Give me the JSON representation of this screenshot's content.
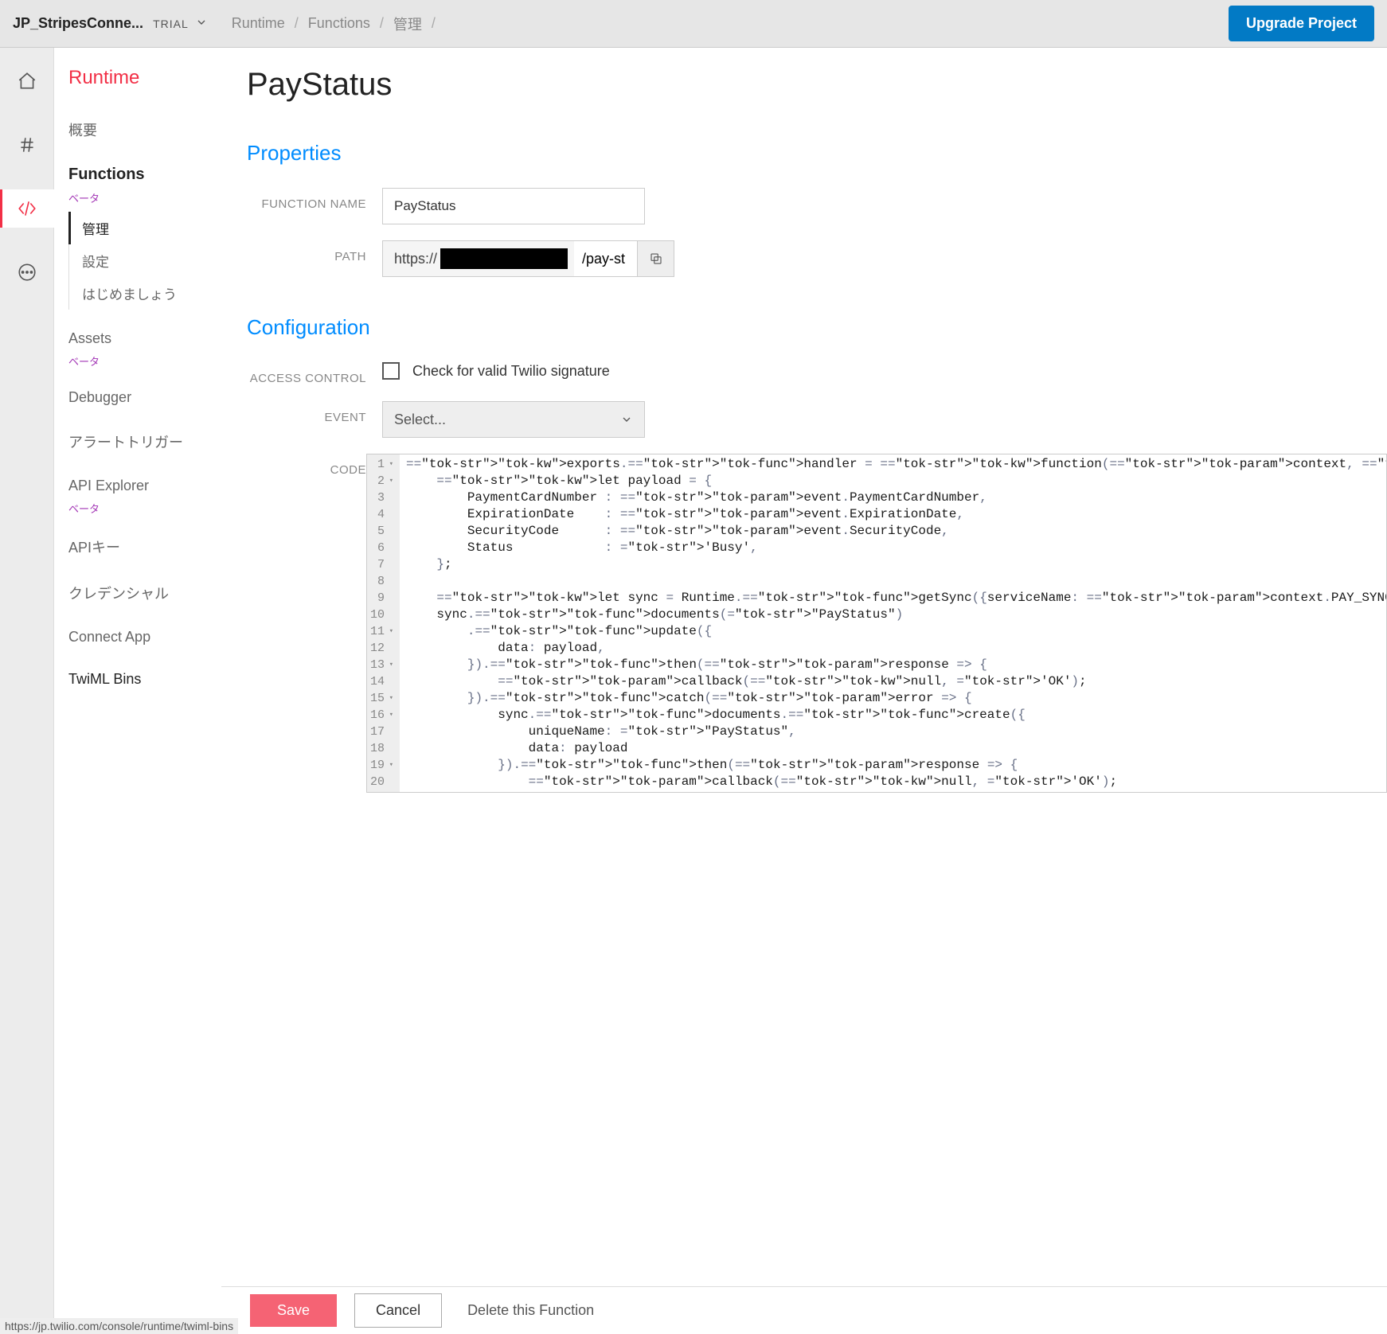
{
  "topbar": {
    "project_name": "JP_StripesConne...",
    "trial": "TRIAL",
    "breadcrumb": [
      "Runtime",
      "Functions",
      "管理"
    ],
    "upgrade": "Upgrade Project"
  },
  "sidebar": {
    "title": "Runtime",
    "overview": "概要",
    "functions": {
      "label": "Functions",
      "badge": "ベータ"
    },
    "subnav": {
      "manage": "管理",
      "settings": "設定",
      "getting_started": "はじめましょう"
    },
    "assets": {
      "label": "Assets",
      "badge": "ベータ"
    },
    "debugger": "Debugger",
    "alert_triggers": "アラートトリガー",
    "api_explorer": {
      "label": "API Explorer",
      "badge": "ベータ"
    },
    "api_keys": "APIキー",
    "credentials": "クレデンシャル",
    "connect_app": "Connect App",
    "twiml_bins": "TwiML Bins"
  },
  "page": {
    "title": "PayStatus",
    "properties_heading": "Properties",
    "configuration_heading": "Configuration",
    "labels": {
      "function_name": "FUNCTION NAME",
      "path": "PATH",
      "access_control": "ACCESS CONTROL",
      "event": "EVENT",
      "code": "CODE"
    },
    "function_name_value": "PayStatus",
    "path_prefix": "https://",
    "path_suffix": "/pay-st",
    "access_checkbox_label": "Check for valid Twilio signature",
    "event_placeholder": "Select...",
    "code_lines": [
      "exports.handler = function(context, event, callback) {",
      "    let payload = {",
      "        PaymentCardNumber : event.PaymentCardNumber,",
      "        ExpirationDate    : event.ExpirationDate,",
      "        SecurityCode      : event.SecurityCode,",
      "        Status            : 'Busy',",
      "    };",
      "",
      "    let sync = Runtime.getSync({serviceName: context.PAY_SYNC_SE",
      "    sync.documents(\"PayStatus\")",
      "        .update({",
      "            data: payload,",
      "        }).then(response => {",
      "            callback(null, 'OK');",
      "        }).catch(error => {",
      "            sync.documents.create({",
      "                uniqueName: \"PayStatus\",",
      "                data: payload",
      "            }).then(response => {",
      "                callback(null, 'OK');"
    ],
    "fold_lines": [
      1,
      2,
      11,
      13,
      15,
      16,
      19
    ]
  },
  "bottombar": {
    "save": "Save",
    "cancel": "Cancel",
    "delete": "Delete this Function"
  },
  "status_url": "https://jp.twilio.com/console/runtime/twiml-bins"
}
